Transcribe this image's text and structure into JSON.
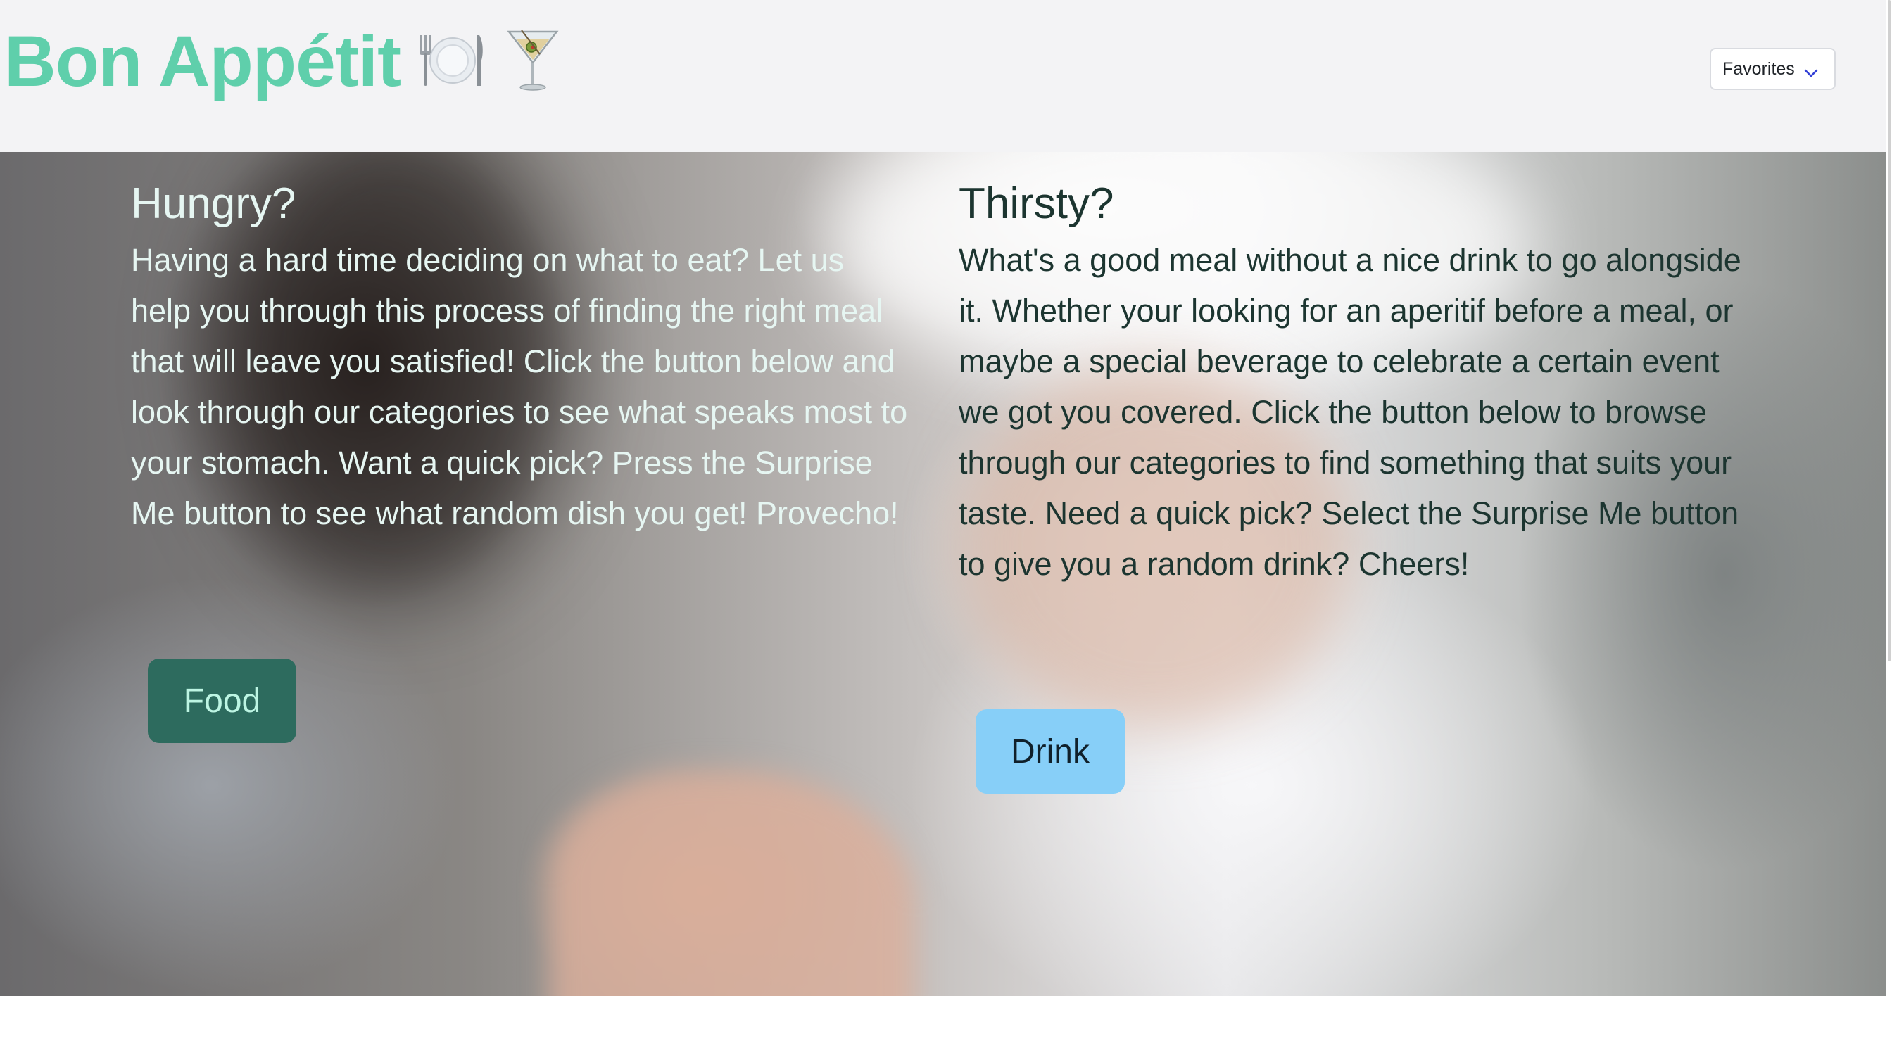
{
  "header": {
    "brand_title": "Bon Appétit",
    "brand_icons": [
      "fork-knife-plate-icon",
      "cocktail-glass-icon"
    ],
    "favorites_label": "Favorites"
  },
  "hungry": {
    "heading": "Hungry?",
    "body": "Having a hard time deciding on what to eat? Let us help you through this process of finding the right meal that will leave you satisfied! Click the button below and look through our categories to see what speaks most to your stomach. Want a quick pick? Press the Surprise Me button to see what random dish you get! Provecho!",
    "button_label": "Food"
  },
  "thirsty": {
    "heading": "Thirsty?",
    "body": "What's a good meal without a nice drink to go alongside it. Whether your looking for an aperitif before a meal, or maybe a special beverage to celebrate a certain event we got you covered. Click the button below to browse through our categories to find something that suits your taste. Need a quick pick? Select the Surprise Me button to give you a random drink? Cheers!",
    "button_label": "Drink"
  },
  "colors": {
    "brand": "#5fcfab",
    "food_button": "#2d6b5e",
    "drink_button": "#87cff8",
    "header_bg": "#f3f3f5"
  }
}
